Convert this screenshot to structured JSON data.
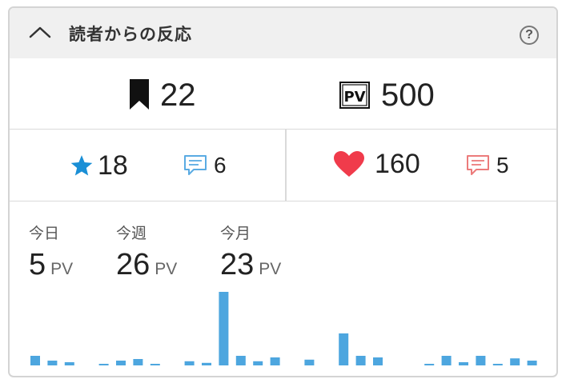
{
  "header": {
    "title": "読者からの反応",
    "help_label": "?"
  },
  "totals": {
    "bookmarks": "22",
    "pv": "500"
  },
  "left_group": {
    "stars": "18",
    "comments": "6"
  },
  "right_group": {
    "likes": "160",
    "comments": "5"
  },
  "summary": [
    {
      "label": "今日",
      "value": "5",
      "unit": "PV"
    },
    {
      "label": "今週",
      "value": "26",
      "unit": "PV"
    },
    {
      "label": "今月",
      "value": "23",
      "unit": "PV"
    }
  ],
  "colors": {
    "accent_blue": "#1a8fd6",
    "bar_blue": "#4da6df",
    "heart_red": "#f03b4b",
    "comment_red": "#ec7b7b",
    "comment_blue": "#5aabe3"
  },
  "chart_data": {
    "type": "bar",
    "values": [
      3,
      1.5,
      1,
      0,
      0.5,
      1.5,
      2,
      0.5,
      0,
      1.3,
      0.8,
      23,
      3,
      1.3,
      2.5,
      0,
      1.8,
      0,
      10,
      3,
      2.5,
      0,
      0,
      0.5,
      3,
      1,
      3,
      0.3,
      2.2,
      1.5
    ],
    "ylim": [
      0,
      23
    ]
  }
}
